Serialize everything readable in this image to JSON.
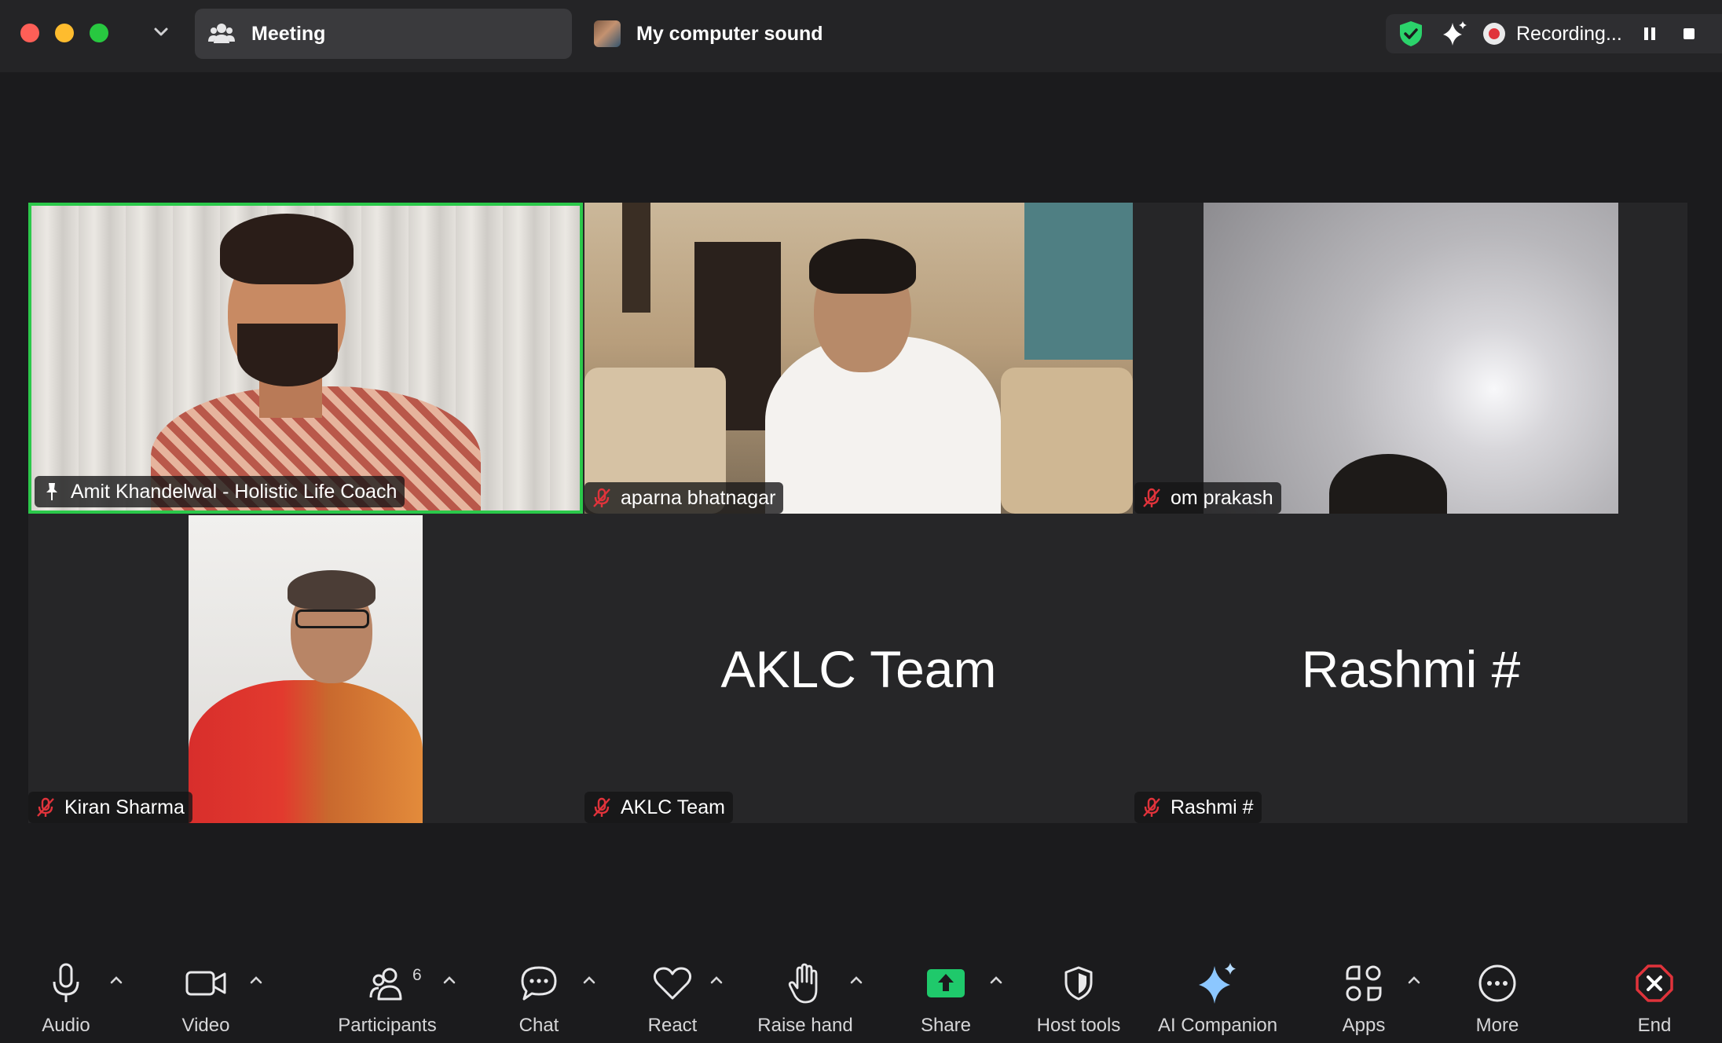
{
  "titlebar": {
    "tab_meeting": "Meeting",
    "tab_sound": "My computer sound",
    "recording_label": "Recording..."
  },
  "participants": [
    {
      "name": "Amit Khandelwal - Holistic Life Coach",
      "video": true,
      "muted": false,
      "active_speaker": true
    },
    {
      "name": "aparna bhatnagar",
      "video": true,
      "muted": true
    },
    {
      "name": "om prakash",
      "video": true,
      "muted": true
    },
    {
      "name": "Kiran Sharma",
      "video": true,
      "muted": true
    },
    {
      "name": "AKLC Team",
      "video": false,
      "muted": true,
      "display_name": "AKLC Team"
    },
    {
      "name": "Rashmi #",
      "video": false,
      "muted": true,
      "display_name": "Rashmi #"
    }
  ],
  "toolbar": {
    "audio": "Audio",
    "video": "Video",
    "participants": "Participants",
    "participants_count": "6",
    "chat": "Chat",
    "react": "React",
    "raise_hand": "Raise hand",
    "share": "Share",
    "host_tools": "Host tools",
    "ai_companion": "AI Companion",
    "apps": "Apps",
    "more": "More",
    "end": "End"
  },
  "colors": {
    "active_speaker_border": "#2bc84a",
    "share_green": "#1fc96b",
    "end_red": "#e0333b",
    "muted_red": "#e0333b",
    "shield_green": "#2bd36b"
  },
  "icons": {
    "muted": "mic-off-icon",
    "unmuted_pin": "pin-icon"
  }
}
